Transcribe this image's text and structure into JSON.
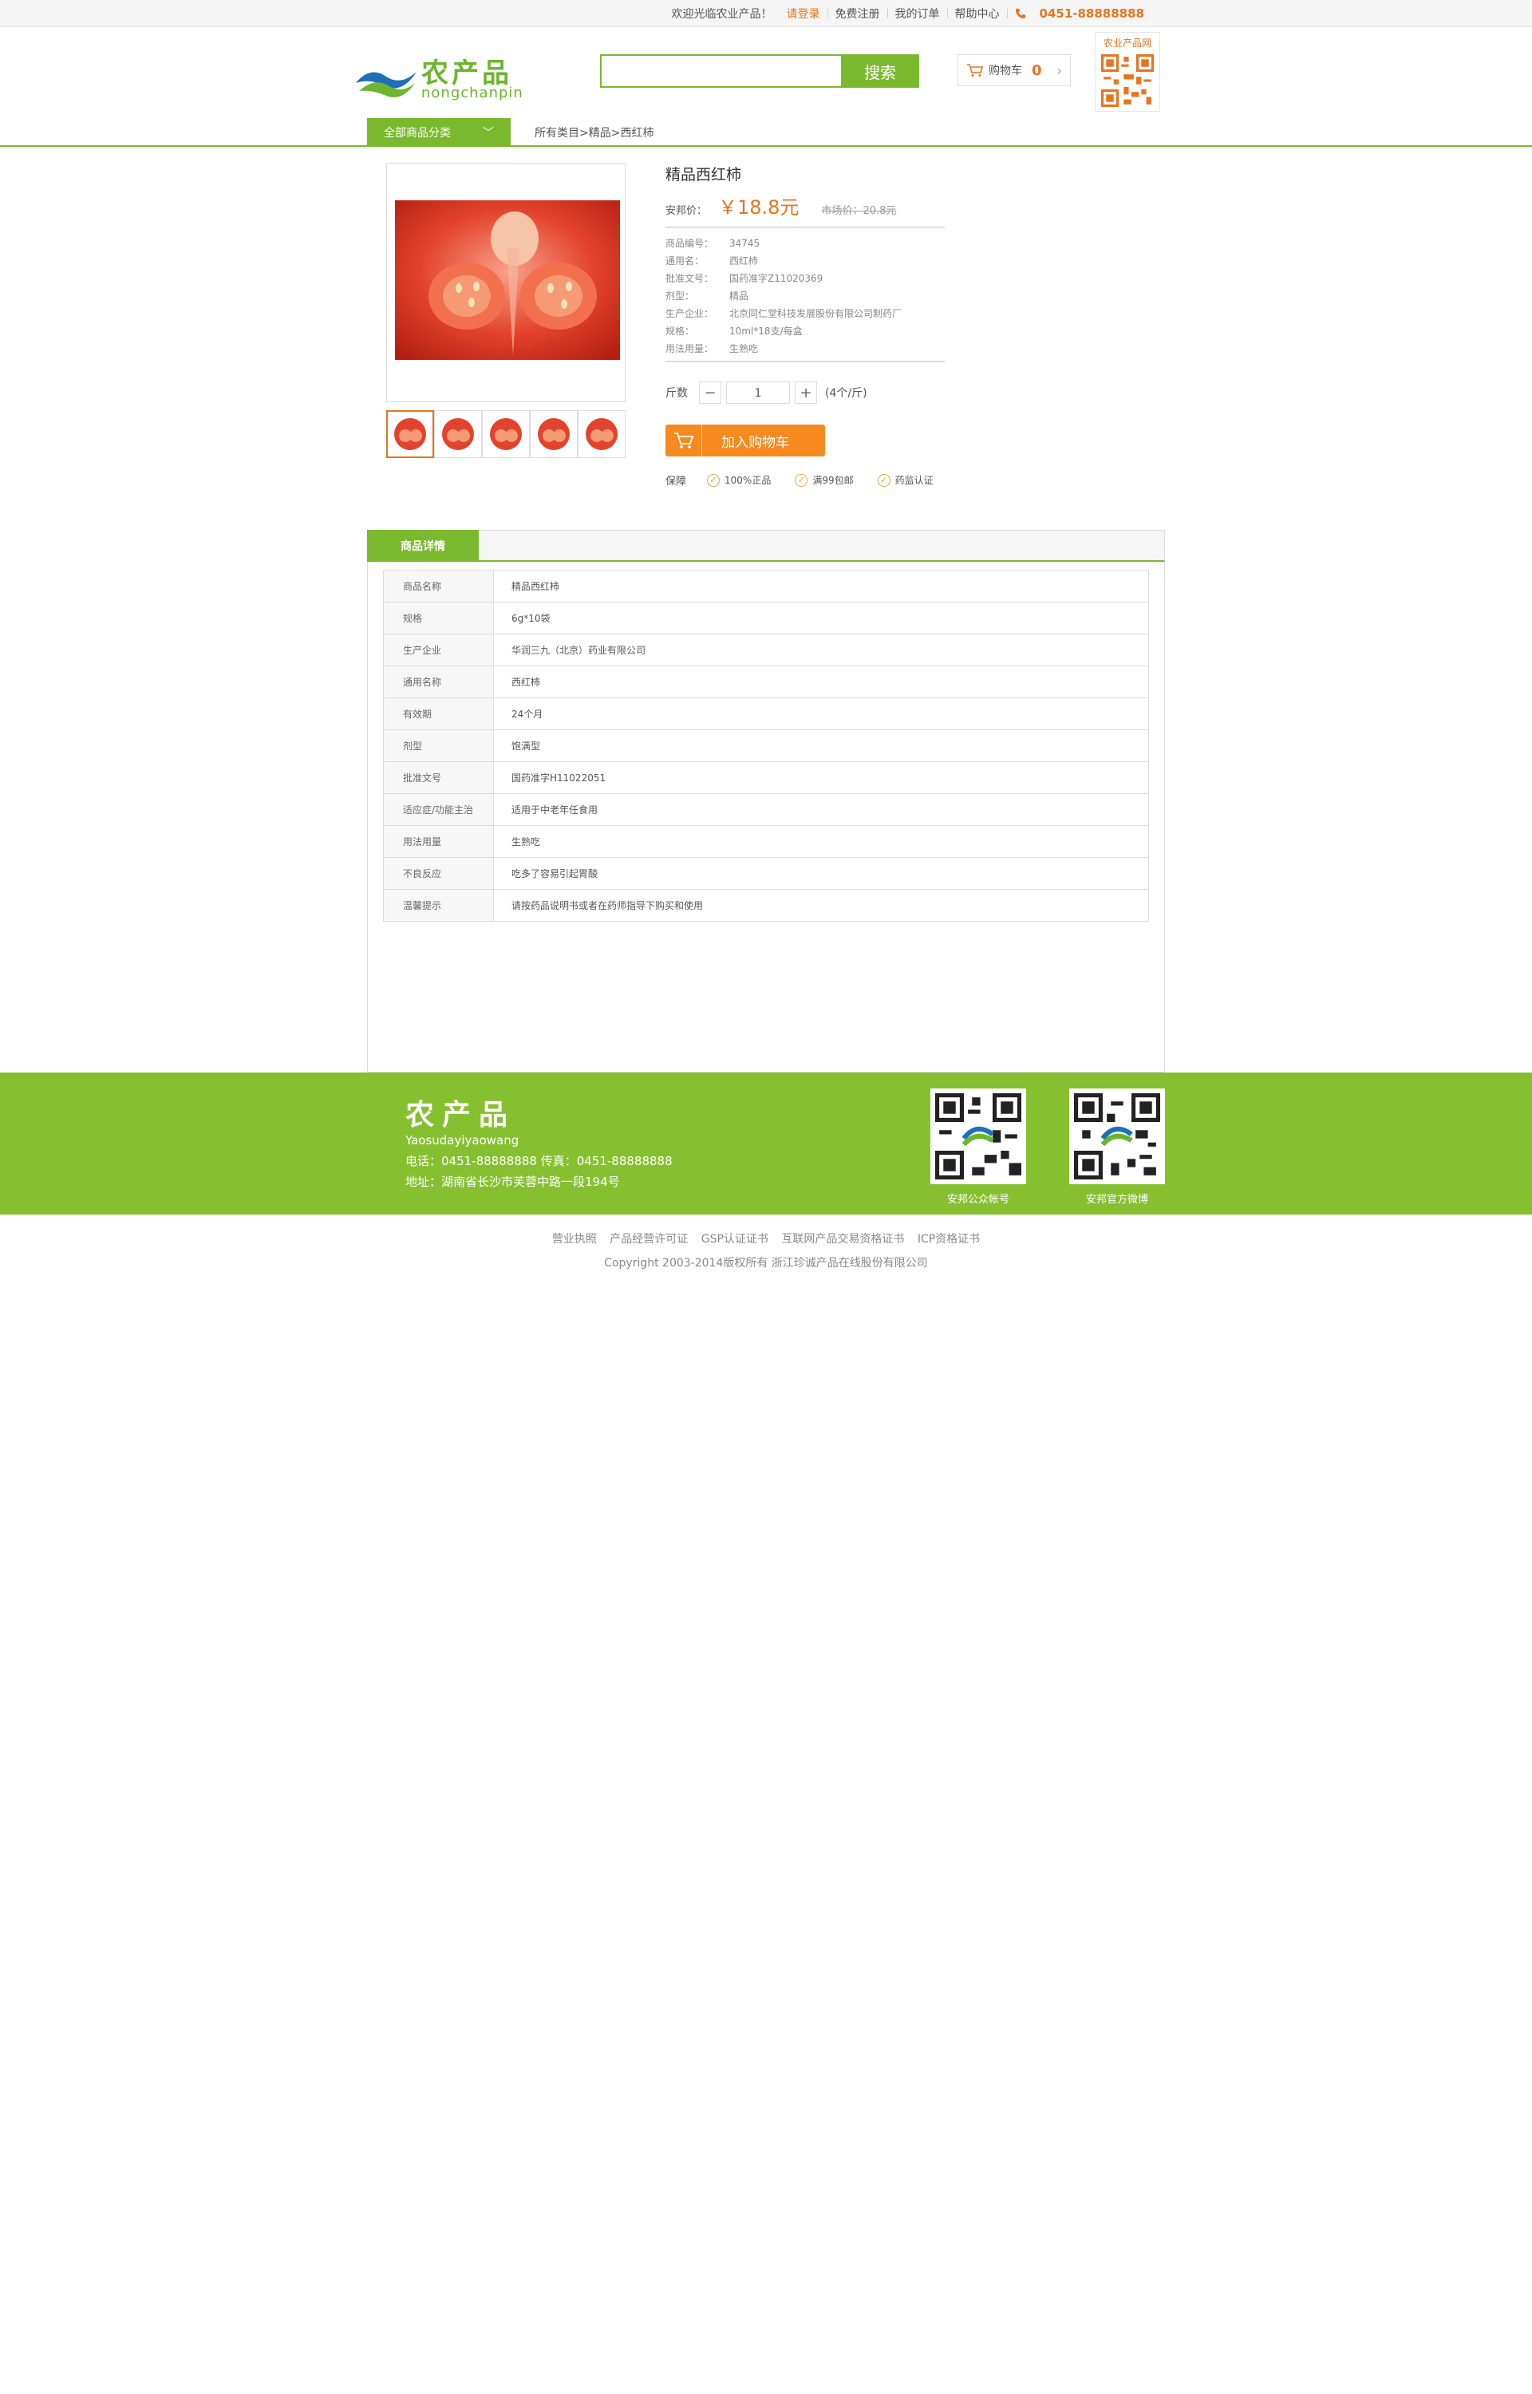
{
  "topbar": {
    "welcome": "欢迎光临农业产品！",
    "login": "请登录",
    "register": "免费注册",
    "orders": "我的订单",
    "help": "帮助中心",
    "phone": "0451-88888888"
  },
  "header": {
    "logo_text": "农产品",
    "logo_sub": "nongchanpin",
    "search_placeholder": "",
    "search_button": "搜索",
    "cart_label": "购物车",
    "cart_count": "0",
    "qr_label": "农业产品网"
  },
  "nav": {
    "category_label": "全部商品分类",
    "breadcrumb": "所有类目>精品>西红柿"
  },
  "product": {
    "title": "精品西红柿",
    "price_label": "安邦价：",
    "price": "￥18.8元",
    "old_price": "市场价：20.8元",
    "specs": [
      {
        "k": "商品编号：",
        "v": "34745"
      },
      {
        "k": "通用名：",
        "v": "西红柿"
      },
      {
        "k": "批准文号：",
        "v": "国药准字Z11020369"
      },
      {
        "k": "剂型：",
        "v": "精品"
      },
      {
        "k": "生产企业：",
        "v": "北京同仁堂科技发展股份有限公司制药厂"
      },
      {
        "k": "规格：",
        "v": "10ml*18支/每盒"
      },
      {
        "k": "用法用量：",
        "v": "生熟吃"
      }
    ],
    "qty_label": "斤数",
    "qty_value": "1",
    "qty_note": "(4个/斤)",
    "add_cart": "加入购物车",
    "guarantee_label": "保障",
    "guarantees": [
      "100%正品",
      "满99包邮",
      "药监认证"
    ]
  },
  "details": {
    "tab": "商品详情",
    "rows": [
      {
        "k": "商品名称",
        "v": "精品西红柿"
      },
      {
        "k": "规格",
        "v": "6g*10袋"
      },
      {
        "k": "生产企业",
        "v": "华润三九（北京）药业有限公司"
      },
      {
        "k": "通用名称",
        "v": "西红柿"
      },
      {
        "k": "有效期",
        "v": "24个月"
      },
      {
        "k": "剂型",
        "v": "饱满型"
      },
      {
        "k": "批准文号",
        "v": "国药准字H11022051"
      },
      {
        "k": "适应症/功能主治",
        "v": "适用于中老年任食用"
      },
      {
        "k": "用法用量",
        "v": "生熟吃"
      },
      {
        "k": "不良反应",
        "v": "吃多了容易引起胃酸"
      },
      {
        "k": "温馨提示",
        "v": "请按药品说明书或者在药师指导下购买和使用"
      }
    ]
  },
  "footer": {
    "title": "农产品",
    "subtitle": "Yaosudayiyaowang",
    "contact": "电话：0451-88888888   传真：0451-88888888",
    "address": "地址：湖南省长沙市芙蓉中路一段194号",
    "qr1_label": "安邦公众帐号",
    "qr2_label": "安邦官方微博",
    "links": [
      "营业执照",
      "产品经营许可证",
      "GSP认证证书",
      "互联网产品交易资格证书",
      "ICP资格证书"
    ],
    "copyright": "Copyright 2003-2014版权所有 浙江珍诚产品在线股份有限公司"
  },
  "colors": {
    "brand_green": "#7ab92d",
    "accent_orange": "#e8741e",
    "footer_green": "#86c030"
  }
}
